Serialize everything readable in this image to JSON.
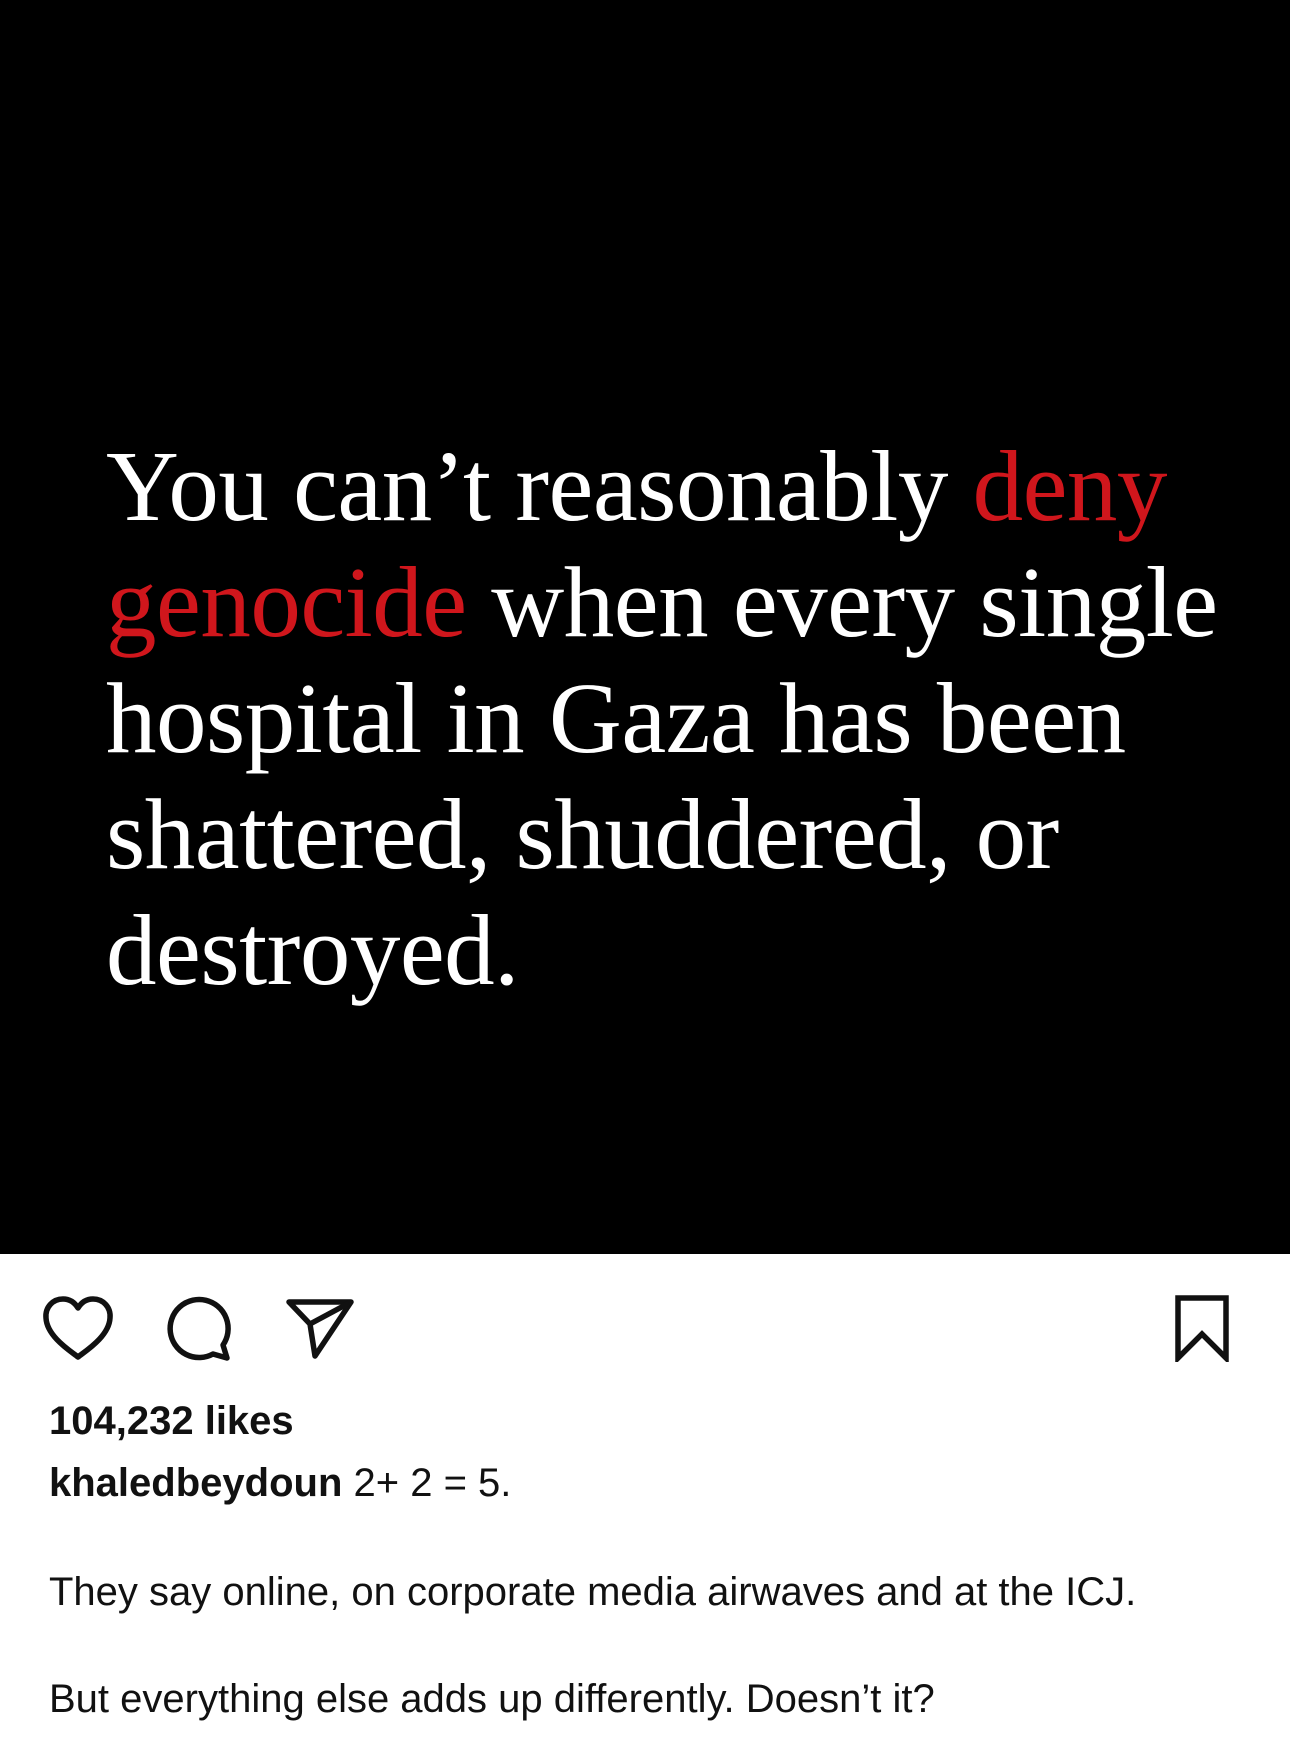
{
  "post": {
    "quote_part1": "You can’t reasonably ",
    "quote_highlight": "deny genocide",
    "quote_part2": " when every single hospital in Gaza has been shattered, shuddered, or destroyed.",
    "highlight_color": "#d0161c",
    "background_color": "#000000"
  },
  "actions": {
    "like_icon": "heart-icon",
    "comment_icon": "comment-bubble-icon",
    "share_icon": "paper-plane-icon",
    "save_icon": "bookmark-icon"
  },
  "meta": {
    "likes": "104,232 likes",
    "username": "khaledbeydoun",
    "caption_first": " 2+ 2 = 5.",
    "paragraph_1": "They say online, on corporate media airwaves and at the ICJ.",
    "paragraph_2": "But everything else adds up differently. Doesn’t it?"
  }
}
